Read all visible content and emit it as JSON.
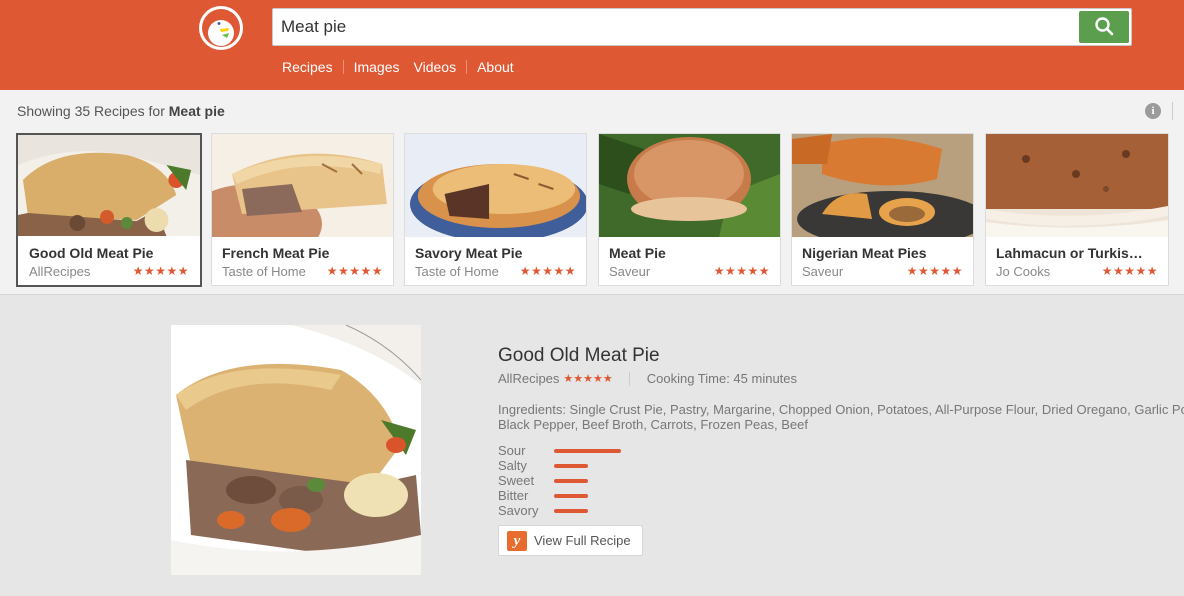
{
  "search": {
    "query": "Meat pie"
  },
  "nav": {
    "recipes": "Recipes",
    "images": "Images",
    "videos": "Videos",
    "about": "About"
  },
  "results": {
    "prefix": "Showing 35 Recipes for ",
    "query": "Meat pie",
    "info": "i"
  },
  "cards": [
    {
      "title": "Good Old Meat Pie",
      "source": "AllRecipes",
      "stars": "★★★★★"
    },
    {
      "title": "French Meat Pie",
      "source": "Taste of Home",
      "stars": "★★★★★"
    },
    {
      "title": "Savory Meat Pie",
      "source": "Taste of Home",
      "stars": "★★★★★"
    },
    {
      "title": "Meat Pie",
      "source": "Saveur",
      "stars": "★★★★★"
    },
    {
      "title": "Nigerian Meat Pies",
      "source": "Saveur",
      "stars": "★★★★★"
    },
    {
      "title": "Lahmacun or Turkish ...",
      "source": "Jo Cooks",
      "stars": "★★★★★"
    }
  ],
  "detail": {
    "title": "Good Old Meat Pie",
    "source": "AllRecipes",
    "stars": "★★★★★",
    "cooking_time": "Cooking Time: 45 minutes",
    "ingredients_line1": "Ingredients: Single Crust Pie, Pastry, Margarine, Chopped Onion, Potatoes, All-Purpose Flour, Dried Oregano, Garlic Po",
    "ingredients_line2": "Black Pepper, Beef Broth, Carrots, Frozen Peas, Beef",
    "flavors": [
      {
        "name": "Sour",
        "level": 1.0
      },
      {
        "name": "Salty",
        "level": 0.5
      },
      {
        "name": "Sweet",
        "level": 0.5
      },
      {
        "name": "Bitter",
        "level": 0.5
      },
      {
        "name": "Savory",
        "level": 0.5
      }
    ],
    "view_label": "View Full Recipe",
    "view_icon": "y"
  },
  "colors": {
    "brand": "#de5833",
    "search_button": "#5b9e4d"
  }
}
